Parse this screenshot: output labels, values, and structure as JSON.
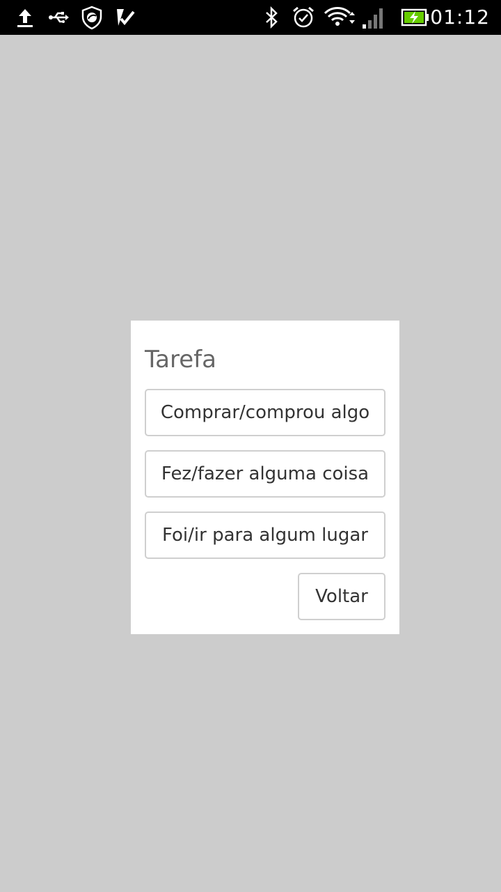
{
  "status_bar": {
    "time": "01:12",
    "left_icons": [
      "upload-icon",
      "usb-icon",
      "shield-icon",
      "checkmark-icon"
    ],
    "right_icons": [
      "bluetooth-icon",
      "alarm-icon",
      "wifi-icon",
      "signal-icon",
      "battery-charging-icon"
    ]
  },
  "dialog": {
    "title": "Tarefa",
    "options": [
      "Comprar/comprou algo",
      "Fez/fazer alguma coisa",
      "Foi/ir para algum lugar"
    ],
    "back_label": "Voltar"
  },
  "colors": {
    "background": "#cccccc",
    "dialog": "#ffffff",
    "status_bar": "#000000",
    "title_text": "#666666",
    "button_text": "#333333",
    "button_border": "#cfcfcf",
    "battery_fill": "#66cc00"
  }
}
